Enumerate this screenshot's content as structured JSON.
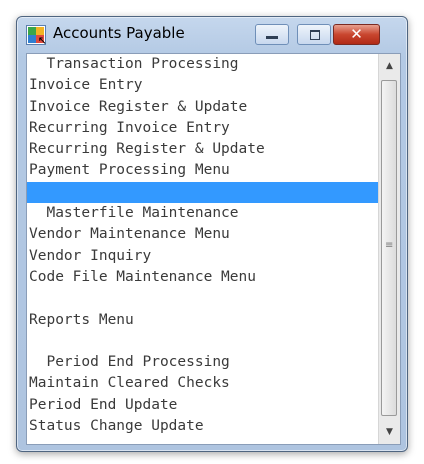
{
  "window": {
    "title": "Accounts Payable",
    "controls": {
      "minimize": "minimize",
      "maximize": "maximize",
      "close": "✕"
    }
  },
  "menu": {
    "items": [
      {
        "label": "  Transaction Processing",
        "kind": "header"
      },
      {
        "label": "Invoice Entry",
        "kind": "item"
      },
      {
        "label": "Invoice Register & Update",
        "kind": "item"
      },
      {
        "label": "Recurring Invoice Entry",
        "kind": "item"
      },
      {
        "label": "Recurring Register & Update",
        "kind": "item"
      },
      {
        "label": "Payment Processing Menu",
        "kind": "item"
      },
      {
        "label": "",
        "kind": "selected"
      },
      {
        "label": "  Masterfile Maintenance",
        "kind": "header"
      },
      {
        "label": "Vendor Maintenance Menu",
        "kind": "item"
      },
      {
        "label": "Vendor Inquiry",
        "kind": "item"
      },
      {
        "label": "Code File Maintenance Menu",
        "kind": "item"
      },
      {
        "label": "",
        "kind": "blank"
      },
      {
        "label": "Reports Menu",
        "kind": "item"
      },
      {
        "label": "",
        "kind": "blank"
      },
      {
        "label": "  Period End Processing",
        "kind": "header"
      },
      {
        "label": "Maintain Cleared Checks",
        "kind": "item"
      },
      {
        "label": "Period End Update",
        "kind": "item"
      },
      {
        "label": "Status Change Update",
        "kind": "item"
      }
    ],
    "selected_color": "#3399ff"
  },
  "scrollbar": {
    "up_icon": "arrow-up",
    "down_icon": "arrow-down"
  }
}
